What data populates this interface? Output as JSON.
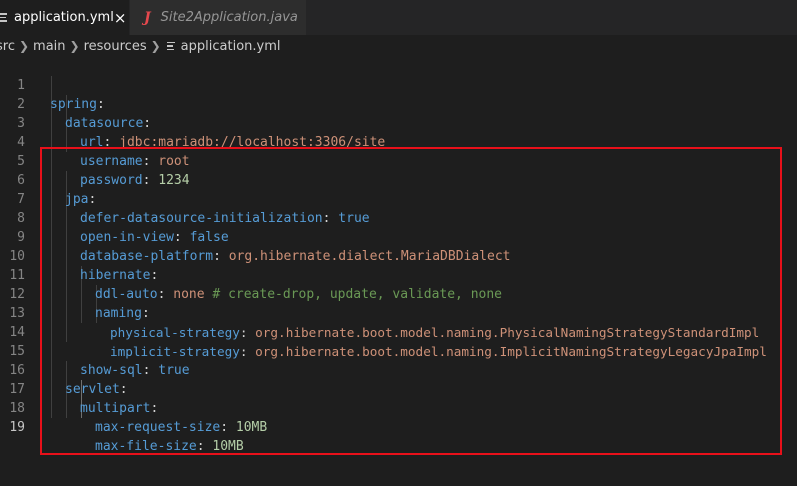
{
  "tabs": [
    {
      "label": "application.yml",
      "close": "×",
      "active": true
    },
    {
      "label": "Site2Application.java",
      "icon_text": "J",
      "active": false
    }
  ],
  "breadcrumb": [
    "src",
    "main",
    "resources",
    "application.yml"
  ],
  "editor": {
    "line_numbers": [
      "1",
      "2",
      "3",
      "4",
      "5",
      "6",
      "7",
      "8",
      "9",
      "10",
      "11",
      "12",
      "13",
      "14",
      "15",
      "16",
      "17",
      "18",
      "19"
    ],
    "lines": [
      [
        "spring",
        ":"
      ],
      [
        "datasource",
        ":"
      ],
      [
        "url",
        ": ",
        "jdbc:mariadb://localhost:3306/site"
      ],
      [
        "username",
        ": ",
        "root"
      ],
      [
        "password",
        ": ",
        "1234"
      ],
      [
        "jpa",
        ":"
      ],
      [
        "defer-datasource-initialization",
        ": ",
        "true"
      ],
      [
        "open-in-view",
        ": ",
        "false"
      ],
      [
        "database-platform",
        ": ",
        "org.hibernate.dialect.MariaDBDialect"
      ],
      [
        "hibernate",
        ":"
      ],
      [
        "ddl-auto",
        ": ",
        "none",
        " # create-drop, update, validate, none"
      ],
      [
        "naming",
        ":"
      ],
      [
        "physical-strategy",
        ": ",
        "org.hibernate.boot.model.naming.PhysicalNamingStrategyStandardImpl"
      ],
      [
        "implicit-strategy",
        ": ",
        "org.hibernate.boot.model.naming.ImplicitNamingStrategyLegacyJpaImpl"
      ],
      [
        "show-sql",
        ": ",
        "true"
      ],
      [
        "servlet",
        ":"
      ],
      [
        "multipart",
        ":"
      ],
      [
        "max-request-size",
        ": ",
        "10MB"
      ],
      [
        "max-file-size",
        ": ",
        "10MB"
      ]
    ]
  },
  "colors": {
    "keyword": "#569cd6",
    "string": "#ce9178",
    "comment": "#6a9955",
    "number": "#b5cea8",
    "highlight_box": "#e8101a",
    "java_icon": "#e5484d"
  }
}
